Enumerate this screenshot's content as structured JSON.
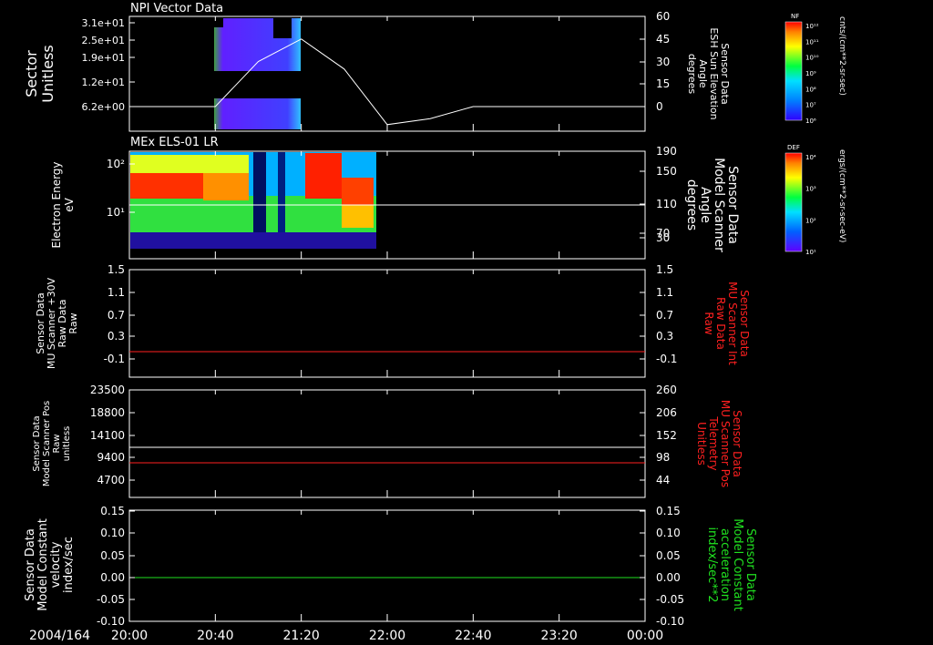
{
  "footer": {
    "date_label": "2004/164",
    "time_ticks": [
      "20:00",
      "20:40",
      "21:20",
      "22:00",
      "22:40",
      "23:20",
      "00:00"
    ]
  },
  "panels": [
    {
      "title": "NPI Vector Data",
      "left_label": [
        "Sector",
        "Unitless"
      ],
      "left_ticks": [
        "3.1e+01",
        "2.5e+01",
        "1.9e+01",
        "1.2e+01",
        "6.2e+00"
      ],
      "right_label": [
        "Sensor Data",
        "ESH Sun Elevation",
        "Angle",
        "degrees"
      ],
      "right_ticks": [
        "60",
        "45",
        "30",
        "15",
        "0"
      ],
      "right_color": "#ffffff"
    },
    {
      "title": "MEx ELS-01 LR",
      "left_label": [
        "Electron Energy",
        "eV"
      ],
      "left_ticks": [
        "10²",
        "10¹"
      ],
      "right_label": [
        "Sensor Data",
        "Model Scanner",
        "Angle",
        "degrees"
      ],
      "right_ticks": [
        "190",
        "150",
        "110",
        "70",
        "30"
      ],
      "right_color": "#ffffff"
    },
    {
      "title": "",
      "left_label": [
        "Sensor Data",
        "MU Scanner +30V",
        "Raw Data",
        "Raw"
      ],
      "left_ticks": [
        "1.5",
        "1.1",
        "0.7",
        "0.3",
        "-0.1"
      ],
      "right_label": [
        "Sensor Data",
        "MU Scanner Int",
        "Raw Data",
        "Raw"
      ],
      "right_ticks": [
        "1.5",
        "1.1",
        "0.7",
        "0.3",
        "-0.1"
      ],
      "right_color": "#ff2020"
    },
    {
      "title": "",
      "left_label": [
        "Sensor Data",
        "Model Scanner Pos",
        "Raw",
        "unitless"
      ],
      "left_ticks": [
        "23500",
        "18800",
        "14100",
        "9400",
        "4700"
      ],
      "right_label": [
        "Sensor Data",
        "MU Scanner Pos",
        "Telemetry",
        "Unitless"
      ],
      "right_ticks": [
        "260",
        "206",
        "152",
        "98",
        "44"
      ],
      "right_color": "#ff2020"
    },
    {
      "title": "",
      "left_label": [
        "Sensor Data",
        "Model Constant",
        "velocity",
        "index/sec"
      ],
      "left_ticks": [
        "0.15",
        "0.10",
        "0.05",
        "0.00",
        "-0.05",
        "-0.10"
      ],
      "right_label": [
        "Sensor Data",
        "Model Constant",
        "acceleration",
        "index/sec**2"
      ],
      "right_ticks": [
        "0.15",
        "0.10",
        "0.05",
        "0.00",
        "-0.05",
        "-0.10"
      ],
      "right_color": "#20e020"
    }
  ],
  "colorbars": [
    {
      "tag": "NF",
      "labels": [
        "10¹²",
        "10¹¹",
        "10¹⁰",
        "10⁹",
        "10⁸",
        "10⁷",
        "10⁶"
      ],
      "unit": "cnts/(cm**2-sr-sec)"
    },
    {
      "tag": "DEF",
      "labels": [
        "10⁴",
        "10³",
        "10²",
        "10¹"
      ],
      "unit": "ergs/(cm**2-sr-sec-eV)"
    }
  ],
  "chart_data": [
    {
      "type": "heatmap",
      "title": "NPI Vector Data",
      "x_range": [
        "20:00",
        "00:00"
      ],
      "xlabel": "",
      "ylabel": "Sector",
      "y_ticks": [
        31,
        25,
        19,
        12,
        6.2
      ],
      "data_time_span": [
        "20:40",
        "21:40"
      ],
      "colorscale_range": [
        1000000.0,
        1000000000000.0
      ],
      "overlay_line": {
        "name": "ESH Sun Elevation Angle",
        "axis": "right",
        "ylim": [
          -15,
          60
        ],
        "x": [
          "20:00",
          "20:40",
          "21:00",
          "21:20",
          "21:40",
          "22:00",
          "22:20",
          "22:40",
          "23:00",
          "00:00"
        ],
        "y": [
          0,
          0,
          30,
          45,
          25,
          -12,
          -8,
          0,
          0,
          0
        ]
      }
    },
    {
      "type": "heatmap",
      "title": "MEx ELS-01 LR",
      "x_range": [
        "20:00",
        "00:00"
      ],
      "ylabel": "Electron Energy (eV)",
      "yscale": "log",
      "ylim": [
        1,
        200
      ],
      "data_time_span": [
        "20:00",
        "21:50"
      ],
      "colorscale_range": [
        10.0,
        10000.0
      ],
      "overlay_line": {
        "name": "Model Scanner Angle",
        "axis": "right",
        "ylim": [
          0,
          190
        ],
        "x": [
          "20:00",
          "00:00"
        ],
        "y": [
          80,
          80
        ]
      }
    },
    {
      "type": "line",
      "x_range": [
        "20:00",
        "00:00"
      ],
      "ylim_left": [
        -0.3,
        1.5
      ],
      "series": [
        {
          "name": "MU Scanner Int Raw Data",
          "axis": "right",
          "color": "#ff2020",
          "x": [
            "20:00",
            "00:00"
          ],
          "y": [
            0,
            0
          ]
        }
      ]
    },
    {
      "type": "line",
      "x_range": [
        "20:00",
        "00:00"
      ],
      "ylim_left": [
        0,
        23500
      ],
      "ylim_right": [
        0,
        260
      ],
      "series": [
        {
          "name": "Model Scanner Pos Raw",
          "axis": "left",
          "color": "#ffffff",
          "x": [
            "20:00",
            "00:00"
          ],
          "y": [
            11500,
            11500
          ]
        },
        {
          "name": "MU Scanner Pos Telemetry",
          "axis": "right",
          "color": "#ff2020",
          "x": [
            "20:00",
            "00:00"
          ],
          "y": [
            98,
            98
          ]
        }
      ]
    },
    {
      "type": "line",
      "x_range": [
        "20:00",
        "00:00"
      ],
      "ylim_left": [
        -0.1,
        0.15
      ],
      "series": [
        {
          "name": "Model Constant acceleration",
          "axis": "right",
          "color": "#20e020",
          "x": [
            "20:00",
            "00:00"
          ],
          "y": [
            0.0,
            0.0
          ]
        }
      ]
    }
  ]
}
